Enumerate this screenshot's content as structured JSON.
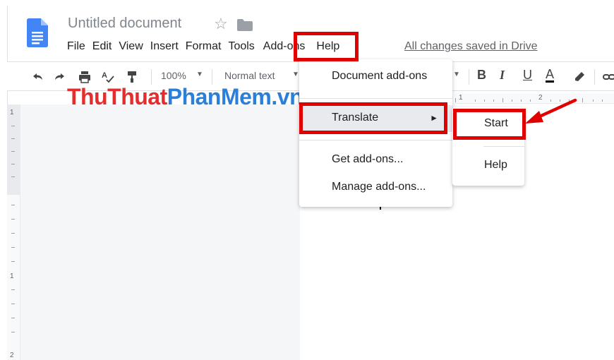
{
  "document": {
    "title": "Untitled document",
    "saved_status": "All changes saved in Drive"
  },
  "menubar": {
    "items": [
      "File",
      "Edit",
      "View",
      "Insert",
      "Format",
      "Tools",
      "Add-ons",
      "Help"
    ]
  },
  "toolbar": {
    "zoom": "100%",
    "style": "Normal text",
    "bold": "B",
    "italic": "I",
    "underline": "U",
    "text_color": "A"
  },
  "ruler": {
    "top_labels": [
      "1",
      "2"
    ],
    "left_labels": [
      "1",
      "1",
      "2"
    ]
  },
  "watermark": {
    "part1": "ThuThuat",
    "part2": "PhanMem.vn"
  },
  "addons_menu": {
    "items": [
      {
        "label": "Document add-ons"
      },
      {
        "label": "Translate",
        "arrow": "►"
      },
      {
        "label": "Get add-ons..."
      },
      {
        "label": "Manage add-ons..."
      }
    ]
  },
  "translate_submenu": {
    "items": [
      {
        "label": "Start"
      },
      {
        "label": "Help"
      }
    ]
  },
  "colors": {
    "highlight": "#e00000",
    "doc_blue": "#4285f4",
    "watermark_red": "#e52d2d",
    "watermark_blue": "#2b7fd9"
  }
}
